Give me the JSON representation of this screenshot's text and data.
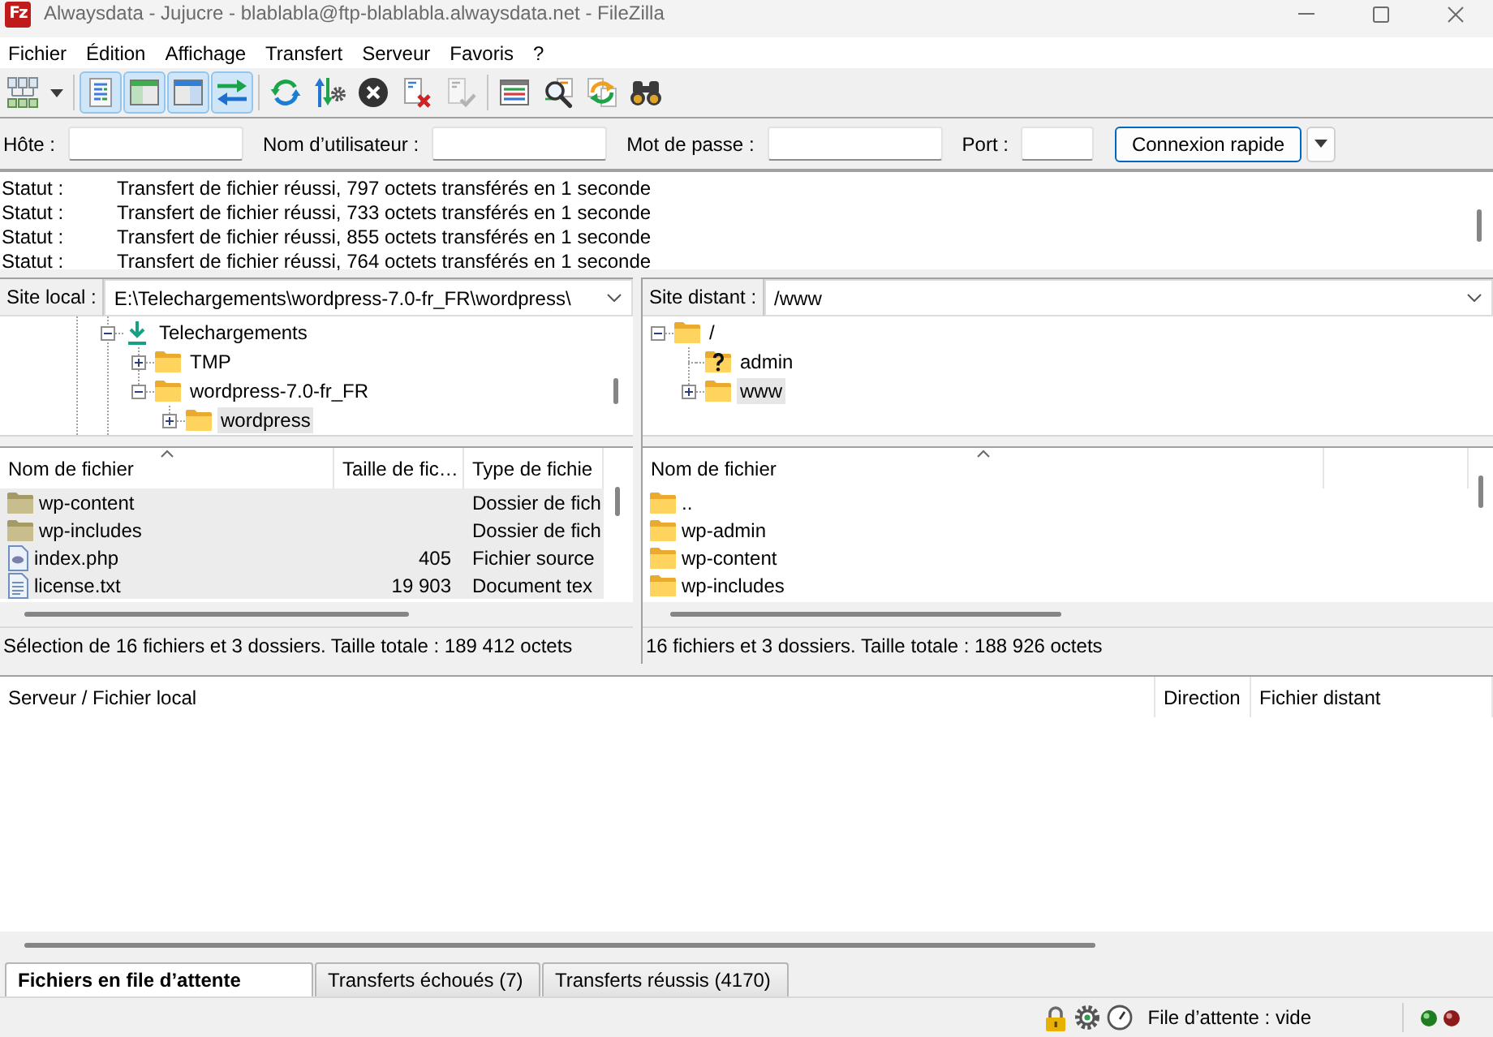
{
  "window": {
    "logo": "Fz",
    "title": "Alwaysdata - Jujucre - blablabla@ftp-blablabla.alwaysdata.net - FileZilla"
  },
  "menu": [
    "Fichier",
    "Édition",
    "Affichage",
    "Transfert",
    "Serveur",
    "Favoris",
    "?"
  ],
  "toolbar": [
    [
      {
        "kind": "site-manager",
        "on": false,
        "disabled": false
      },
      {
        "kind": "site-menu",
        "on": false,
        "disabled": false
      }
    ],
    [
      {
        "kind": "message-log",
        "on": true,
        "disabled": false
      },
      {
        "kind": "local-tree",
        "on": true,
        "disabled": false
      },
      {
        "kind": "remote-tree",
        "on": true,
        "disabled": false
      },
      {
        "kind": "transfer-queue",
        "on": true,
        "disabled": false
      }
    ],
    [
      {
        "kind": "refresh",
        "on": false,
        "disabled": false
      },
      {
        "kind": "process-queue",
        "on": false,
        "disabled": false
      },
      {
        "kind": "cancel",
        "on": false,
        "disabled": false
      },
      {
        "kind": "disconnect",
        "on": false,
        "disabled": false
      },
      {
        "kind": "reconnect",
        "on": false,
        "disabled": true
      }
    ],
    [
      {
        "kind": "filter",
        "on": false,
        "disabled": false
      },
      {
        "kind": "compare",
        "on": false,
        "disabled": false
      },
      {
        "kind": "sync-browsing",
        "on": false,
        "disabled": false
      },
      {
        "kind": "search",
        "on": false,
        "disabled": false
      }
    ]
  ],
  "quickconnect": {
    "fields": [
      {
        "label": "Hôte :"
      },
      {
        "label": "Nom d’utilisateur :"
      },
      {
        "label": "Mot de passe :"
      },
      {
        "label": "Port :"
      }
    ],
    "connect_button": "Connexion rapide"
  },
  "log": [
    {
      "label": "Statut :",
      "text": "Transfert de fichier réussi, 797 octets transférés en 1 seconde"
    },
    {
      "label": "Statut :",
      "text": "Transfert de fichier réussi, 733 octets transférés en 1 seconde"
    },
    {
      "label": "Statut :",
      "text": "Transfert de fichier réussi, 855 octets transférés en 1 seconde"
    },
    {
      "label": "Statut :",
      "text": "Transfert de fichier réussi, 764 octets transférés en 1 seconde"
    }
  ],
  "local": {
    "label": "Site local :",
    "path": "E:\\Telechargements\\wordpress-7.0-fr_FR\\wordpress\\",
    "tree": [
      {
        "name": "Telechargements",
        "kind": "download",
        "expanded": true,
        "selected": false,
        "children": [
          {
            "name": "TMP",
            "kind": "folder",
            "expanded": false,
            "selected": false
          },
          {
            "name": "wordpress-7.0-fr_FR",
            "kind": "folder",
            "expanded": true,
            "selected": false,
            "children": [
              {
                "name": "wordpress",
                "kind": "folder",
                "expanded": false,
                "selected": true
              }
            ]
          }
        ]
      }
    ],
    "columns": [
      {
        "label": "Nom de fichier",
        "sorted": true
      },
      {
        "label": "Taille de fic…",
        "sorted": false
      },
      {
        "label": "Type de fichie",
        "sorted": false
      }
    ],
    "rows": [
      {
        "kind": "folder",
        "name": "wp-content",
        "type": "Dossier de fich",
        "selected": true
      },
      {
        "kind": "folder",
        "name": "wp-includes",
        "type": "Dossier de fich",
        "selected": true
      },
      {
        "kind": "code",
        "name": "index.php",
        "size": "405",
        "type": "Fichier source",
        "selected": true
      },
      {
        "kind": "text",
        "name": "license.txt",
        "size": "19 903",
        "type": "Document tex",
        "selected": true
      }
    ],
    "status": "Sélection de 16 fichiers et 3 dossiers. Taille totale : 189 412 octets"
  },
  "remote": {
    "label": "Site distant :",
    "path": "/www",
    "tree": [
      {
        "name": "/",
        "kind": "folder",
        "expanded": true,
        "selected": false,
        "children": [
          {
            "name": "admin",
            "kind": "unknown",
            "selected": false
          },
          {
            "name": "www",
            "kind": "folder",
            "expanded": false,
            "selected": true
          }
        ]
      }
    ],
    "columns": [
      {
        "label": "Nom de fichier",
        "sorted": true
      },
      {
        "sorted": false
      }
    ],
    "rows": [
      {
        "kind": "folder",
        "name": "..",
        "selected": false
      },
      {
        "kind": "folder",
        "name": "wp-admin",
        "selected": false
      },
      {
        "kind": "folder",
        "name": "wp-content",
        "selected": false
      },
      {
        "kind": "folder",
        "name": "wp-includes",
        "selected": false
      }
    ],
    "status": "16 fichiers et 3 dossiers. Taille totale : 188 926 octets"
  },
  "queue": {
    "columns": [
      "Serveur / Fichier local",
      "Direction",
      "Fichier distant"
    ],
    "tabs": [
      {
        "label": "Fichiers en file d’attente",
        "selected": true
      },
      {
        "label": "Transferts échoués (7)",
        "selected": false
      },
      {
        "label": "Transferts réussis (4170)",
        "selected": false
      }
    ]
  },
  "status_bar": {
    "queue_status": "File d’attente : vide"
  }
}
